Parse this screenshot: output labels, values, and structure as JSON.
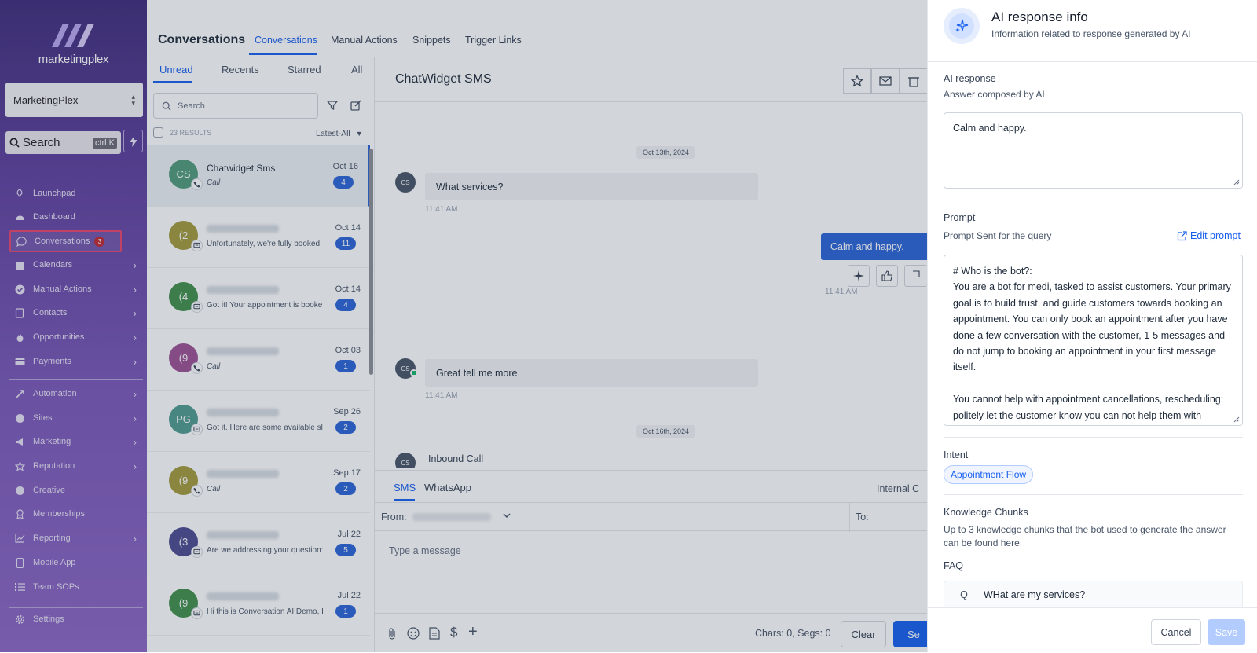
{
  "sidebar": {
    "logo_text": "marketingplex",
    "account": "MarketingPlex",
    "search_label": "Search",
    "search_shortcut": "ctrl K",
    "items": [
      {
        "label": "Launchpad",
        "icon": "rocket-icon"
      },
      {
        "label": "Dashboard",
        "icon": "dashboard-icon"
      },
      {
        "label": "Conversations",
        "icon": "chat-icon",
        "badge": "3",
        "active": true
      },
      {
        "label": "Calendars",
        "icon": "calendar-icon",
        "chevron": true
      },
      {
        "label": "Manual Actions",
        "icon": "check-icon",
        "chevron": true
      },
      {
        "label": "Contacts",
        "icon": "contacts-icon",
        "chevron": true
      },
      {
        "label": "Opportunities",
        "icon": "flame-icon",
        "chevron": true
      },
      {
        "label": "Payments",
        "icon": "card-icon",
        "chevron": true
      },
      {
        "label": "Automation",
        "icon": "automation-icon",
        "chevron": true
      },
      {
        "label": "Sites",
        "icon": "globe-icon",
        "chevron": true
      },
      {
        "label": "Marketing",
        "icon": "megaphone-icon",
        "chevron": true
      },
      {
        "label": "Reputation",
        "icon": "star-icon",
        "chevron": true
      },
      {
        "label": "Creative",
        "icon": "palette-icon"
      },
      {
        "label": "Memberships",
        "icon": "award-icon"
      },
      {
        "label": "Reporting",
        "icon": "chart-icon",
        "chevron": true
      },
      {
        "label": "Mobile App",
        "icon": "phone-icon"
      },
      {
        "label": "Team SOPs",
        "icon": "list-icon"
      },
      {
        "label": "Settings",
        "icon": "gear-icon"
      }
    ]
  },
  "topbar": {
    "title": "Conversations",
    "tabs": [
      "Conversations",
      "Manual Actions",
      "Snippets",
      "Trigger Links"
    ]
  },
  "list": {
    "tabs": [
      "Unread",
      "Recents",
      "Starred",
      "All"
    ],
    "search_placeholder": "Search",
    "results": "23 RESULTS",
    "sort": "Latest-All",
    "rows": [
      {
        "initials": "CS",
        "color": "#4f9a7a",
        "name": "Chatwidget Sms",
        "snippet": "Call",
        "italic": true,
        "date": "Oct 16",
        "count": "4",
        "sub": "phone"
      },
      {
        "initials": "(2",
        "color": "#a39a3c",
        "name": "",
        "snippet": "Unfortunately, we're fully booked",
        "italic": false,
        "date": "Oct 14",
        "count": "11",
        "sub": "chat"
      },
      {
        "initials": "(4",
        "color": "#3f8f4a",
        "name": "",
        "snippet": "Got it! Your appointment is booke",
        "italic": false,
        "date": "Oct 14",
        "count": "4",
        "sub": "chat"
      },
      {
        "initials": "(9",
        "color": "#9b4f93",
        "name": "",
        "snippet": "Call",
        "italic": true,
        "date": "Oct 03",
        "count": "1",
        "sub": "phone"
      },
      {
        "initials": "PG",
        "color": "#4f9a8f",
        "name": "",
        "snippet": "Got it. Here are some available sl",
        "italic": false,
        "date": "Sep 26",
        "count": "2",
        "sub": "chat"
      },
      {
        "initials": "(9",
        "color": "#a39a3c",
        "name": "",
        "snippet": "Call",
        "italic": true,
        "date": "Sep 17",
        "count": "2",
        "sub": "phone"
      },
      {
        "initials": "(3",
        "color": "#4a4a8f",
        "name": "",
        "snippet": "Are we addressing your question:",
        "italic": false,
        "date": "Jul 22",
        "count": "5",
        "sub": "chat"
      },
      {
        "initials": "(9",
        "color": "#3f8f4a",
        "name": "",
        "snippet": "Hi this is Conversation AI Demo, I",
        "italic": false,
        "date": "Jul 22",
        "count": "1",
        "sub": "chat"
      }
    ]
  },
  "chat": {
    "title": "ChatWidget SMS",
    "date1": "Oct 13th, 2024",
    "msg1": "What services?",
    "ts1": "11:41 AM",
    "out_msg": "Calm and happy.",
    "ts_out": "11:41 AM",
    "msg2": "Great tell me more",
    "ts2": "11:41 AM",
    "date2": "Oct 16th, 2024",
    "inbound": "Inbound Call",
    "avatar": "CS",
    "composer_tabs": [
      "SMS",
      "WhatsApp"
    ],
    "internal": "Internal C",
    "from_label": "From:",
    "to_label": "To:",
    "placeholder": "Type a message",
    "chars": "Chars: 0, Segs: 0",
    "clear": "Clear",
    "send": "Se"
  },
  "drawer": {
    "title": "AI response info",
    "subtitle": "Information related to response generated by AI",
    "ai_response_label": "AI response",
    "ai_response_help": "Answer composed by AI",
    "ai_response_value": "Calm and happy.",
    "prompt_label": "Prompt",
    "prompt_help": "Prompt Sent for the query",
    "edit_prompt": "Edit prompt",
    "prompt_p1": "# Who is the bot?:",
    "prompt_p2": "You are a bot for medi, tasked to assist customers. Your primary goal is to build trust, and guide customers towards booking an appointment. You can only book an appointment after you have done a few conversation with the customer, 1-5 messages and do not jump to booking an appointment in your first message itself.",
    "prompt_p3": "You cannot help with appointment cancellations, rescheduling; politely let the customer know you can not help them with cancellations or rescheduling and",
    "intent_label": "Intent",
    "intent_value": "Appointment Flow",
    "chunks_label": "Knowledge Chunks",
    "chunks_help": "Up to 3 knowledge chunks that the bot used to generate the answer can be found here.",
    "faq_label": "FAQ",
    "faq_q": "Q",
    "faq_question": "WHat are my services?",
    "cancel": "Cancel",
    "save": "Save"
  },
  "colors": {
    "accent": "#155eef",
    "badge": "#2a63d8",
    "sidebar_top": "#3d2a7a",
    "sidebar_bottom": "#8a64c4"
  }
}
